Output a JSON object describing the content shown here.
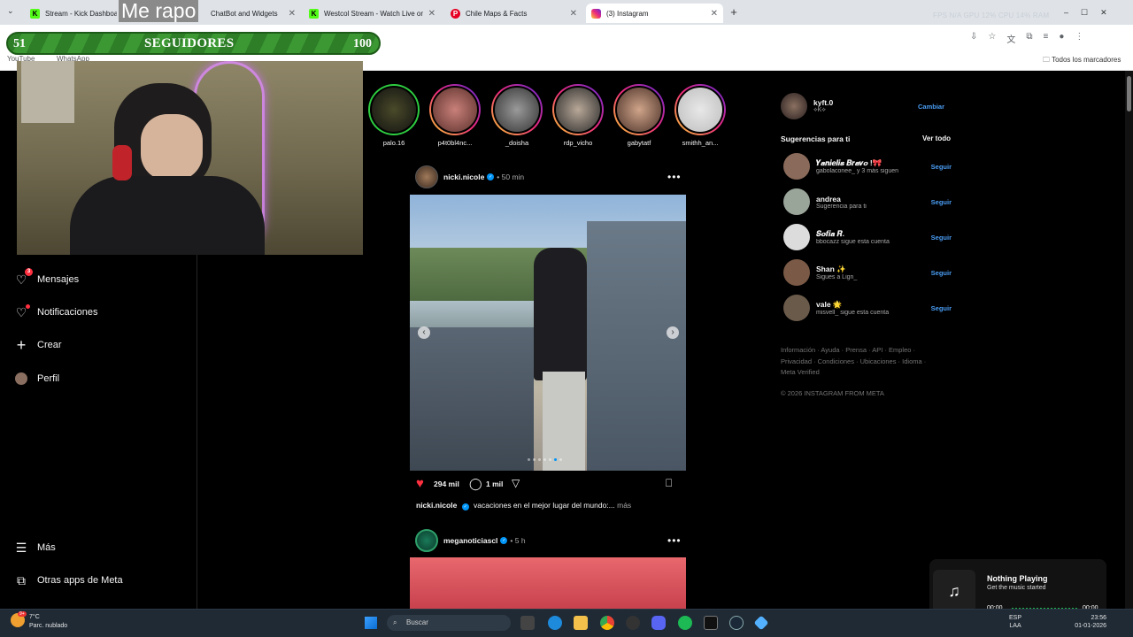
{
  "browser": {
    "tabs": [
      {
        "label": "Stream - Kick Dashboard",
        "icon": "kick-icon",
        "color": "#53fc18"
      },
      {
        "label": "ChatBot and Widgets",
        "icon": "widget-icon",
        "color": "#3b82f6"
      },
      {
        "label": "Westcol Stream - Watch Live on",
        "icon": "kick-icon",
        "color": "#53fc18"
      },
      {
        "label": "Chile Maps & Facts",
        "icon": "pinterest-icon",
        "color": "#e60023"
      },
      {
        "label": "(3) Instagram",
        "icon": "instagram-icon",
        "color": "#e1306c"
      }
    ],
    "stats": "FPS N/A   GPU 12%   CPU 14%   RAM",
    "bookmarks": {
      "youtube": "YouTube",
      "whatsapp": "WhatsApp",
      "all": "Todos los marcadores"
    }
  },
  "overlay": {
    "title": "Me rapo",
    "followers": {
      "current": "51",
      "label": "SEGUIDORES",
      "goal": "100",
      "progress": 0.51
    }
  },
  "instagram": {
    "nav": [
      {
        "label": "Mensajes",
        "icon": "messenger-icon",
        "badge": "3"
      },
      {
        "label": "Notificaciones",
        "icon": "heart-icon"
      },
      {
        "label": "Crear",
        "icon": "plus-icon"
      },
      {
        "label": "Perfil",
        "icon": "avatar-icon"
      },
      {
        "label": "Más",
        "icon": "menu-icon"
      },
      {
        "label": "Otras apps de Meta",
        "icon": "apps-icon"
      }
    ],
    "stories": [
      {
        "name": "palo.16",
        "seen": true
      },
      {
        "name": "p4t0bl4nc...",
        "seen": false
      },
      {
        "name": "_doisha",
        "seen": false
      },
      {
        "name": "rdp_vicho",
        "seen": false
      },
      {
        "name": "gabytatf",
        "seen": false
      },
      {
        "name": "smithh_an...",
        "seen": false
      }
    ],
    "post1": {
      "user": "nicki.nicole",
      "time": "50 min",
      "likes": "294 mil",
      "comments": "1 mil",
      "caption_user": "nicki.nicole",
      "caption": "vacaciones en el mejor lugar del mundo:...",
      "more": "más"
    },
    "post2": {
      "user": "meganoticiascl",
      "time": "5 h"
    },
    "account": {
      "username": "kyft.0",
      "name": "⟡K⟡",
      "switch": "Cambiar"
    },
    "suggestions_title": "Sugerencias para ti",
    "see_all": "Ver todo",
    "suggestions": [
      {
        "name": "𝒀𝒂𝒏𝒊𝒆𝒍𝒊𝒔 𝑩𝒓𝒂𝒗𝒐 !🎀",
        "sub": "gabolaconee_ y 3 más siguen",
        "action": "Seguir",
        "color": "#8a6a5a"
      },
      {
        "name": "andrea",
        "sub": "Sugerencia para ti",
        "action": "Seguir",
        "color": "#9aa59a"
      },
      {
        "name": "𝑺𝒐𝒇𝒊𝒂 𝑹.",
        "sub": "bbocazz sigue esta cuenta",
        "action": "Seguir",
        "color": "#dcdcdc"
      },
      {
        "name": "Shan ✨",
        "sub": "Sigues a Lign_",
        "action": "Seguir",
        "color": "#7a5a46"
      },
      {
        "name": "vale 🌟",
        "sub": "misvell_ sigue esta cuenta",
        "action": "Seguir",
        "color": "#6a5a4a"
      }
    ],
    "footer": "Información · Ayuda · Prensa · API · Empleo · Privacidad · Condiciones · Ubicaciones · Idioma · Meta Verified",
    "copyright": "© 2026 INSTAGRAM FROM META"
  },
  "music": {
    "title": "Nothing Playing",
    "subtitle": "Get the music started",
    "elapsed": "00:00",
    "total": "00:00"
  },
  "taskbar": {
    "weather_temp": "7°C",
    "weather_desc": "Parc. nublado",
    "weather_badge": "9+",
    "search": "Buscar",
    "lang": "ESP",
    "lang2": "LAA",
    "time": "23:56",
    "date": "01-01-2026"
  }
}
